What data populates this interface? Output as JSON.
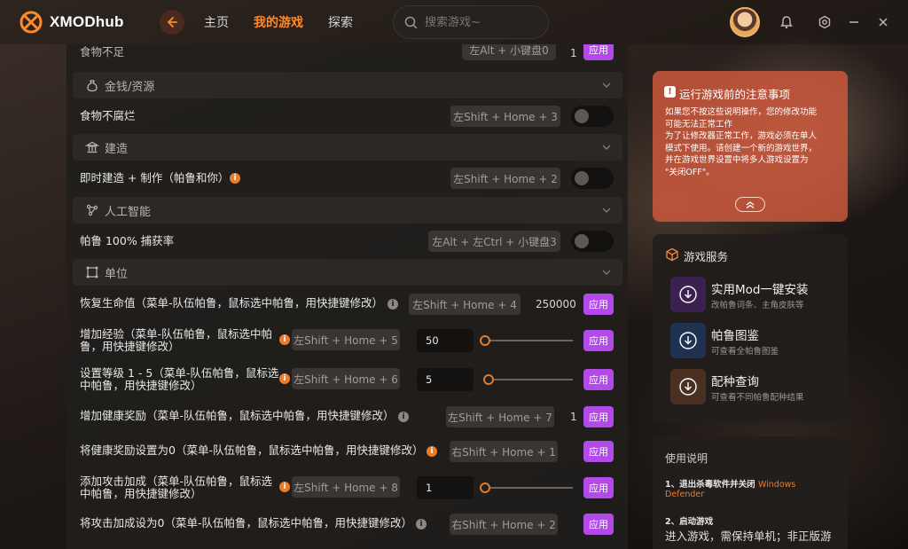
{
  "app": {
    "name": "XMODhub"
  },
  "nav": {
    "home": "主页",
    "my_games": "我的游戏",
    "explore": "探索"
  },
  "search": {
    "placeholder": "搜索游戏~"
  },
  "sections": {
    "money": "金钱/资源",
    "build": "建造",
    "ai": "人工智能",
    "unit": "单位"
  },
  "rows": {
    "top_partial": {
      "label": "食物不足",
      "key": "左Alt + 小键盘0",
      "value": "1",
      "apply": "应用"
    },
    "no_spoil": {
      "label": "食物不腐烂",
      "key": "左Shift + Home + 3"
    },
    "instant_build": {
      "label": "即时建造 + 制作（帕鲁和你）",
      "key": "左Shift + Home + 2"
    },
    "capture": {
      "label": "帕鲁 100% 捕获率",
      "key": "左Alt + 左Ctrl + 小键盘3"
    },
    "restore_hp": {
      "label": "恢复生命值（菜单-队伍帕鲁，鼠标选中帕鲁，用快捷键修改）",
      "key": "左Shift + Home + 4",
      "value": "250000",
      "apply": "应用"
    },
    "add_exp": {
      "label_1": "增加经验（菜单-队伍帕鲁，鼠标选中帕",
      "label_2": "鲁，用快捷键修改）",
      "key": "左Shift + Home + 5",
      "value": "50",
      "apply": "应用"
    },
    "set_level": {
      "label_1": "设置等级 1 - 5（菜单-队伍帕鲁，鼠标选",
      "label_2": "中帕鲁，用快捷键修改）",
      "key": "左Shift + Home + 6",
      "value": "5",
      "apply": "应用"
    },
    "health_bonus": {
      "label": "增加健康奖励（菜单-队伍帕鲁，鼠标选中帕鲁，用快捷键修改）",
      "key": "左Shift + Home + 7",
      "value": "1",
      "apply": "应用"
    },
    "health_zero": {
      "label": "将健康奖励设置为0（菜单-队伍帕鲁，鼠标选中帕鲁，用快捷键修改）",
      "key": "右Shift + Home + 1",
      "apply": "应用"
    },
    "add_attack": {
      "label_1": "添加攻击加成（菜单-队伍帕鲁，鼠标选",
      "label_2": "中帕鲁，用快捷键修改）",
      "key": "左Shift + Home + 8",
      "value": "1",
      "apply": "应用"
    },
    "attack_zero": {
      "label": "将攻击加成设为0（菜单-队伍帕鲁，鼠标选中帕鲁，用快捷键修改）",
      "key": "右Shift + Home + 2",
      "apply": "应用"
    }
  },
  "notice": {
    "title": "运行游戏前的注意事项",
    "lines": [
      "如果您不按这些说明操作，您的修改功能",
      "可能无法正常工作",
      "为了让修改器正常工作，游戏必须在单人",
      "模式下使用。请创建一个新的游戏世界，",
      "并在游戏世界设置中将多人游戏设置为",
      "\"关闭OFF\"。"
    ]
  },
  "services": {
    "title": "游戏服务",
    "items": [
      {
        "title": "实用Mod一键安装",
        "sub": "改帕鲁词条、主角皮肤等"
      },
      {
        "title": "帕鲁图鉴",
        "sub": "可查看全帕鲁图鉴"
      },
      {
        "title": "配种查询",
        "sub": "可查看不同帕鲁配种结果"
      }
    ]
  },
  "usage": {
    "title": "使用说明",
    "step1": "1、退出杀毒软件并关闭",
    "step1_hl_a": "Windows",
    "step1_hl_b": "Defender",
    "step2": "2、启动游戏",
    "step2_text": "进入游戏，需保持单机；非正版游"
  },
  "colors": {
    "accent": "#ff8a2a",
    "apply": "#b14ae8",
    "notice": "#ca583c"
  }
}
